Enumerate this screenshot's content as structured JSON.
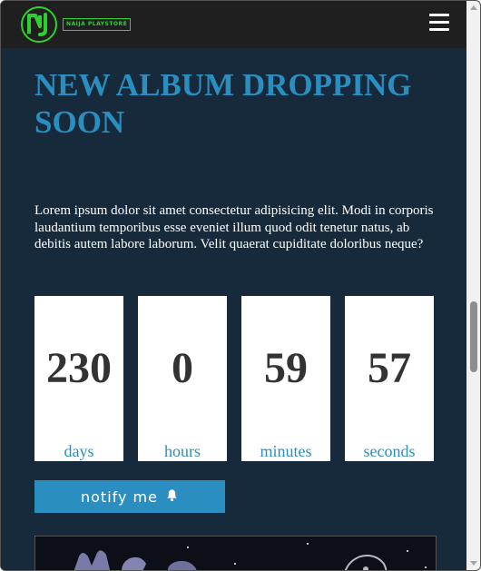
{
  "header": {
    "logo_text": "NAIJA PLAYSTORE",
    "logo_icon": "nj-logo-icon",
    "menu_icon": "hamburger-menu-icon"
  },
  "main": {
    "title": "NEW ALBUM DROPPING SOON",
    "description": "Lorem ipsum dolor sit amet consectetur adipisicing elit. Modi in corporis laudantium temporibus esse eveniet illum quod odit tenetur natus, ab debitis autem labore laborum. Velit quaerat cupiditate doloribus neque?",
    "countdown": [
      {
        "value": "230",
        "label": "days"
      },
      {
        "value": "0",
        "label": "hours"
      },
      {
        "value": "59",
        "label": "minutes"
      },
      {
        "value": "57",
        "label": "seconds"
      }
    ],
    "notify_label": "notify me",
    "notify_icon": "bell-icon"
  },
  "colors": {
    "background": "#162a3b",
    "header": "#1f1f1f",
    "accent": "#2b8ec0",
    "logo_green": "#2ed12e"
  }
}
